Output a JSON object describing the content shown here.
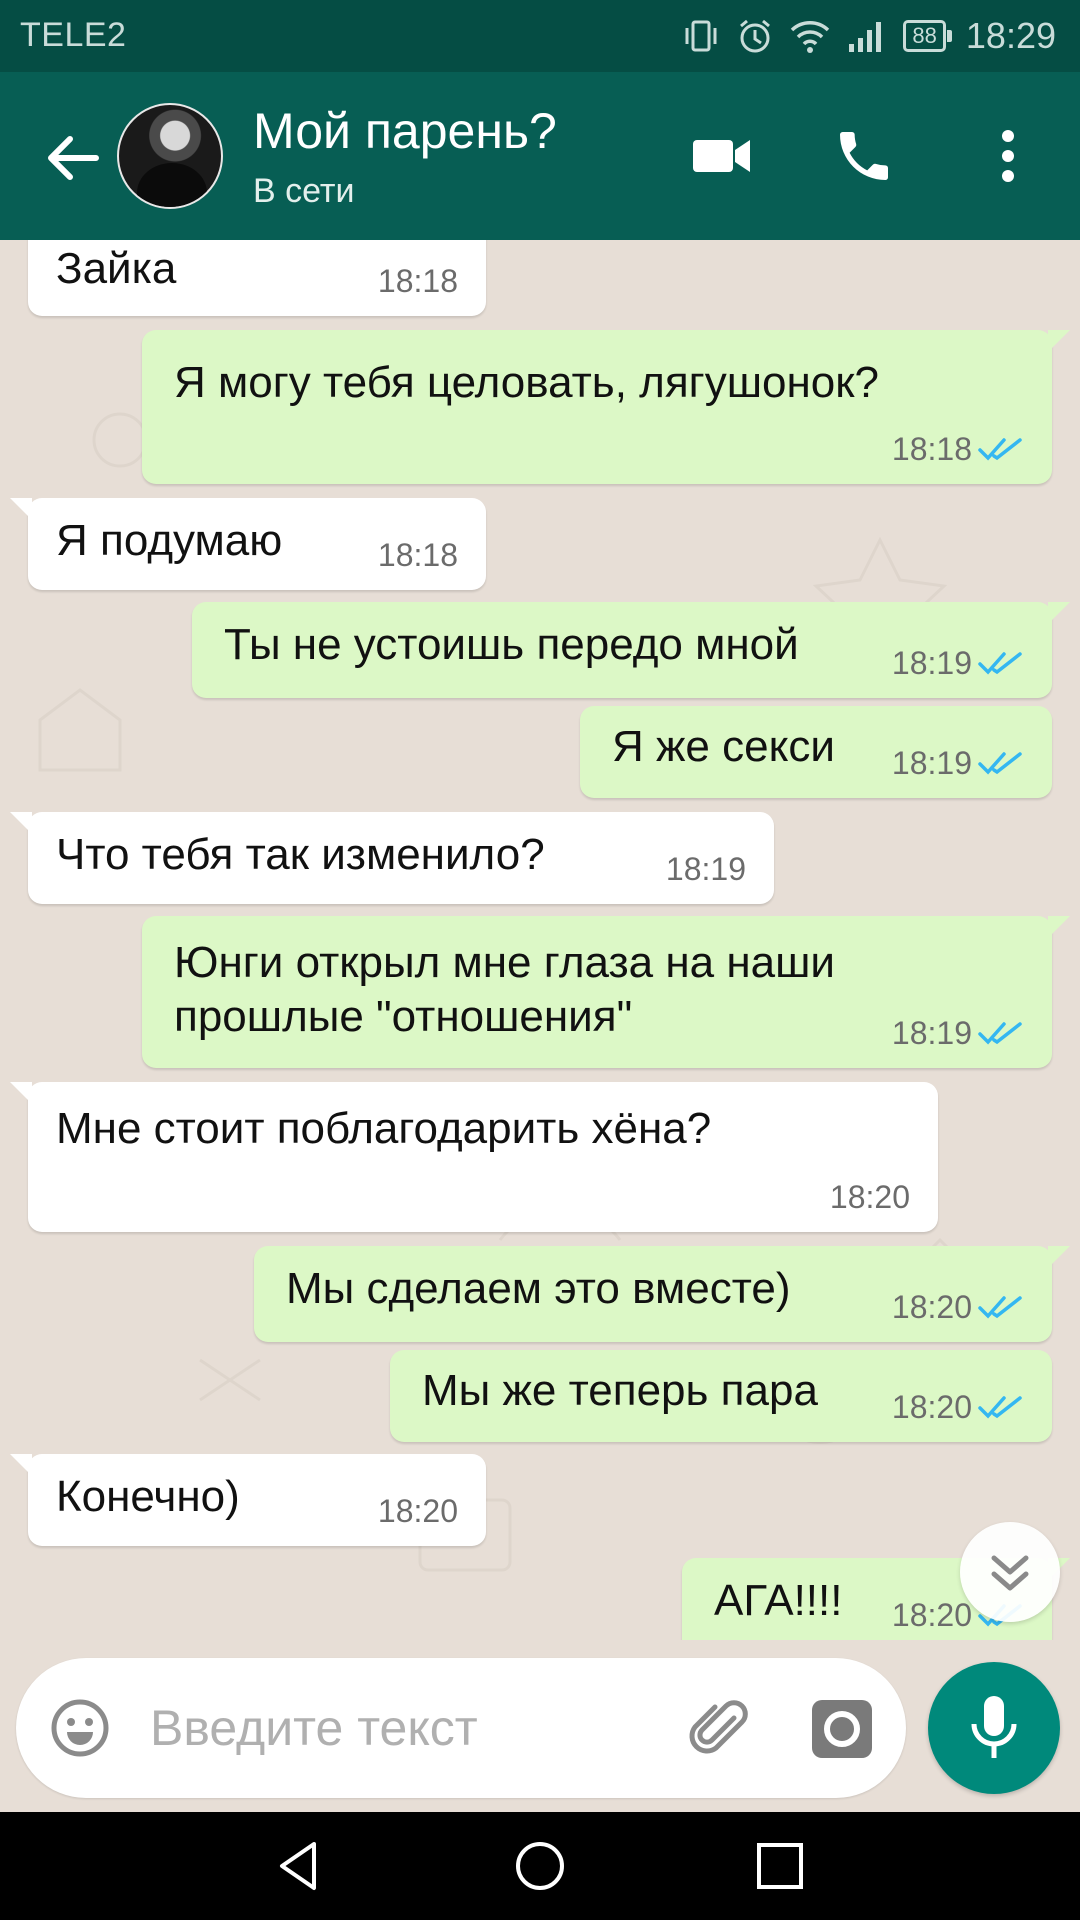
{
  "status_bar": {
    "carrier": "TELE2",
    "battery": "88",
    "time": "18:29",
    "icons": [
      "vibrate-icon",
      "alarm-icon",
      "wifi-icon",
      "signal-icon",
      "battery-icon"
    ]
  },
  "header": {
    "back_icon": "arrow-left-icon",
    "contact_name": "Мой парень?",
    "contact_status": "В сети",
    "actions": [
      "video-call-icon",
      "voice-call-icon",
      "more-vert-icon"
    ]
  },
  "messages": [
    {
      "direction": "in",
      "text": "Зайка",
      "time": "18:18"
    },
    {
      "direction": "out",
      "text": "Я могу тебя целовать, лягушонок?",
      "time": "18:18",
      "read": true
    },
    {
      "direction": "in",
      "text": "Я подумаю",
      "time": "18:18"
    },
    {
      "direction": "out",
      "text": "Ты не устоишь передо мной",
      "time": "18:19",
      "read": true
    },
    {
      "direction": "out",
      "text": "Я же секси",
      "time": "18:19",
      "read": true
    },
    {
      "direction": "in",
      "text": "Что тебя так изменило?",
      "time": "18:19"
    },
    {
      "direction": "out",
      "text": "Юнги открыл мне глаза на наши\nпрошлые \"отношения\"",
      "time": "18:19",
      "read": true
    },
    {
      "direction": "in",
      "text": "Мне стоит поблагодарить хёна?",
      "time": "18:20"
    },
    {
      "direction": "out",
      "text": "Мы сделаем это вместе)",
      "time": "18:20",
      "read": true
    },
    {
      "direction": "out",
      "text": "Мы же теперь пара",
      "time": "18:20",
      "read": true
    },
    {
      "direction": "in",
      "text": "Конечно)",
      "time": "18:20"
    },
    {
      "direction": "out",
      "text": "АГА!!!!",
      "time": "18:20",
      "read": true
    }
  ],
  "composer": {
    "placeholder": "Введите текст",
    "emoji_icon": "emoji-icon",
    "attach_icon": "paperclip-icon",
    "camera_icon": "camera-icon",
    "mic_icon": "mic-icon"
  },
  "scroll_button_icon": "chevron-double-down-icon",
  "nav_bar": [
    "back-triangle-icon",
    "home-circle-icon",
    "recents-square-icon"
  ],
  "colors": {
    "header": "#075e54",
    "status_bar": "#054d44",
    "outgoing_bubble": "#dcf8c6",
    "incoming_bubble": "#ffffff",
    "chat_background": "#e7ded6",
    "read_ticks": "#34b7f1",
    "mic_button": "#00897b"
  }
}
